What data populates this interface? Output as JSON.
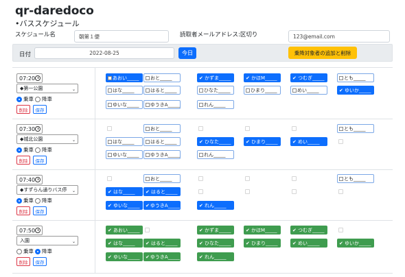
{
  "header": {
    "title": "qr-daredoco",
    "subtitle": "•バススケジュール"
  },
  "form": {
    "schedule_label": "スケジュール名",
    "schedule_value": "朝第１便",
    "email_label": "読取者メールアドレス:区切り",
    "email_value": "123@email.com"
  },
  "datebar": {
    "date_label": "日付",
    "date_value": "2022-08-25",
    "today_label": "今日",
    "manage_label": "乗降対象者の追加と削除"
  },
  "rows": [
    {
      "time": "07:20",
      "stop": "◆第一公園",
      "board_label": "乗車",
      "alight_label": "降車",
      "mode": "board",
      "delete_label": "削除",
      "save_label": "保存"
    },
    {
      "time": "07:30",
      "stop": "◆城北公園",
      "board_label": "乗車",
      "alight_label": "降車",
      "mode": "board",
      "delete_label": "削除",
      "save_label": "保存"
    },
    {
      "time": "07:40",
      "stop": "◆すずらん通りバス停",
      "board_label": "乗車",
      "alight_label": "降車",
      "mode": "board",
      "delete_label": "削除",
      "save_label": "保存"
    },
    {
      "time": "07:50",
      "stop": "入園",
      "board_label": "乗車",
      "alight_label": "降車",
      "mode": "alight",
      "delete_label": "削除",
      "save_label": "保存"
    }
  ],
  "chips": {
    "r0": [
      {
        "label": "あおい_____",
        "state": "blue"
      },
      {
        "label": "おと_____",
        "state": "off"
      },
      {
        "label": "かずま_____",
        "state": "blue"
      },
      {
        "label": "かほM_____",
        "state": "blue"
      },
      {
        "label": "つむぎ_____",
        "state": "blue"
      },
      {
        "label": "とも_____",
        "state": "off"
      },
      {
        "label": "はな_____",
        "state": "off"
      },
      {
        "label": "はると_____",
        "state": "off"
      },
      {
        "label": "ひなた_____",
        "state": "off"
      },
      {
        "label": "ひまり_____",
        "state": "off"
      },
      {
        "label": "めい_____",
        "state": "off"
      },
      {
        "label": "ゆいか_____",
        "state": "blue"
      },
      {
        "label": "ゆいな_____",
        "state": "off"
      },
      {
        "label": "ゆうきA_____",
        "state": "off"
      },
      {
        "label": "れん_____",
        "state": "off"
      }
    ],
    "r1": [
      {
        "label": "おと_____",
        "state": "off"
      },
      {
        "label": "とも_____",
        "state": "off"
      },
      {
        "label": "はな_____",
        "state": "off"
      },
      {
        "label": "はると_____",
        "state": "off"
      },
      {
        "label": "ひなた_____",
        "state": "blue"
      },
      {
        "label": "ひまり_____",
        "state": "blue"
      },
      {
        "label": "めい_____",
        "state": "blue"
      },
      {
        "label": "ゆいな_____",
        "state": "off"
      },
      {
        "label": "ゆうきA_____",
        "state": "off"
      },
      {
        "label": "れん_____",
        "state": "off"
      }
    ],
    "r2": [
      {
        "label": "おと_____",
        "state": "off"
      },
      {
        "label": "とも_____",
        "state": "off"
      },
      {
        "label": "はな_____",
        "state": "blue"
      },
      {
        "label": "はると_____",
        "state": "blue"
      },
      {
        "label": "ゆいな_____",
        "state": "blue"
      },
      {
        "label": "ゆうきA_____",
        "state": "blue"
      },
      {
        "label": "れん_____",
        "state": "blue"
      }
    ],
    "r3": [
      {
        "label": "あおい_____",
        "state": "green"
      },
      {
        "label": "かずま_____",
        "state": "green"
      },
      {
        "label": "かほM_____",
        "state": "green"
      },
      {
        "label": "つむぎ_____",
        "state": "green"
      },
      {
        "label": "はな_____",
        "state": "green"
      },
      {
        "label": "はると_____",
        "state": "green"
      },
      {
        "label": "ひなた_____",
        "state": "green"
      },
      {
        "label": "ひまり_____",
        "state": "green"
      },
      {
        "label": "めい_____",
        "state": "green"
      },
      {
        "label": "ゆいか_____",
        "state": "green"
      },
      {
        "label": "ゆいな_____",
        "state": "green"
      },
      {
        "label": "ゆうきA_____",
        "state": "green"
      },
      {
        "label": "れん_____",
        "state": "green"
      }
    ]
  },
  "colors": {
    "primary": "#0d6efd",
    "success": "#3f9c4f",
    "warning": "#ffc107",
    "danger": "#dc3545"
  }
}
